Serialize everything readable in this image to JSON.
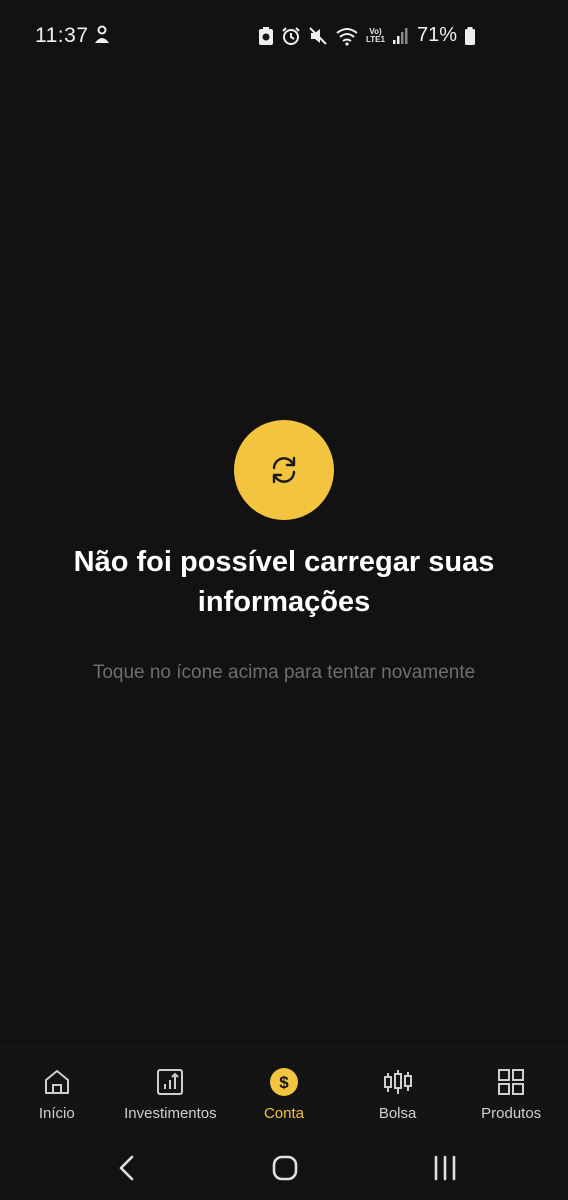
{
  "status_bar": {
    "time": "11:37",
    "battery_percent": "71%",
    "network_label_top": "Vo)",
    "network_label_bottom": "LTE1"
  },
  "error": {
    "title": "Não foi possível carregar suas informações",
    "subtitle": "Toque no ícone acima para tentar novamente"
  },
  "bottom_nav": {
    "items": [
      {
        "label": "Início",
        "icon": "home-icon"
      },
      {
        "label": "Investimentos",
        "icon": "chart-icon"
      },
      {
        "label": "Conta",
        "icon": "dollar-icon",
        "active": true
      },
      {
        "label": "Bolsa",
        "icon": "candlestick-icon"
      },
      {
        "label": "Produtos",
        "icon": "grid-icon"
      }
    ]
  },
  "colors": {
    "background": "#121212",
    "accent": "#f2c440",
    "subtitle": "#6e6e6e"
  }
}
